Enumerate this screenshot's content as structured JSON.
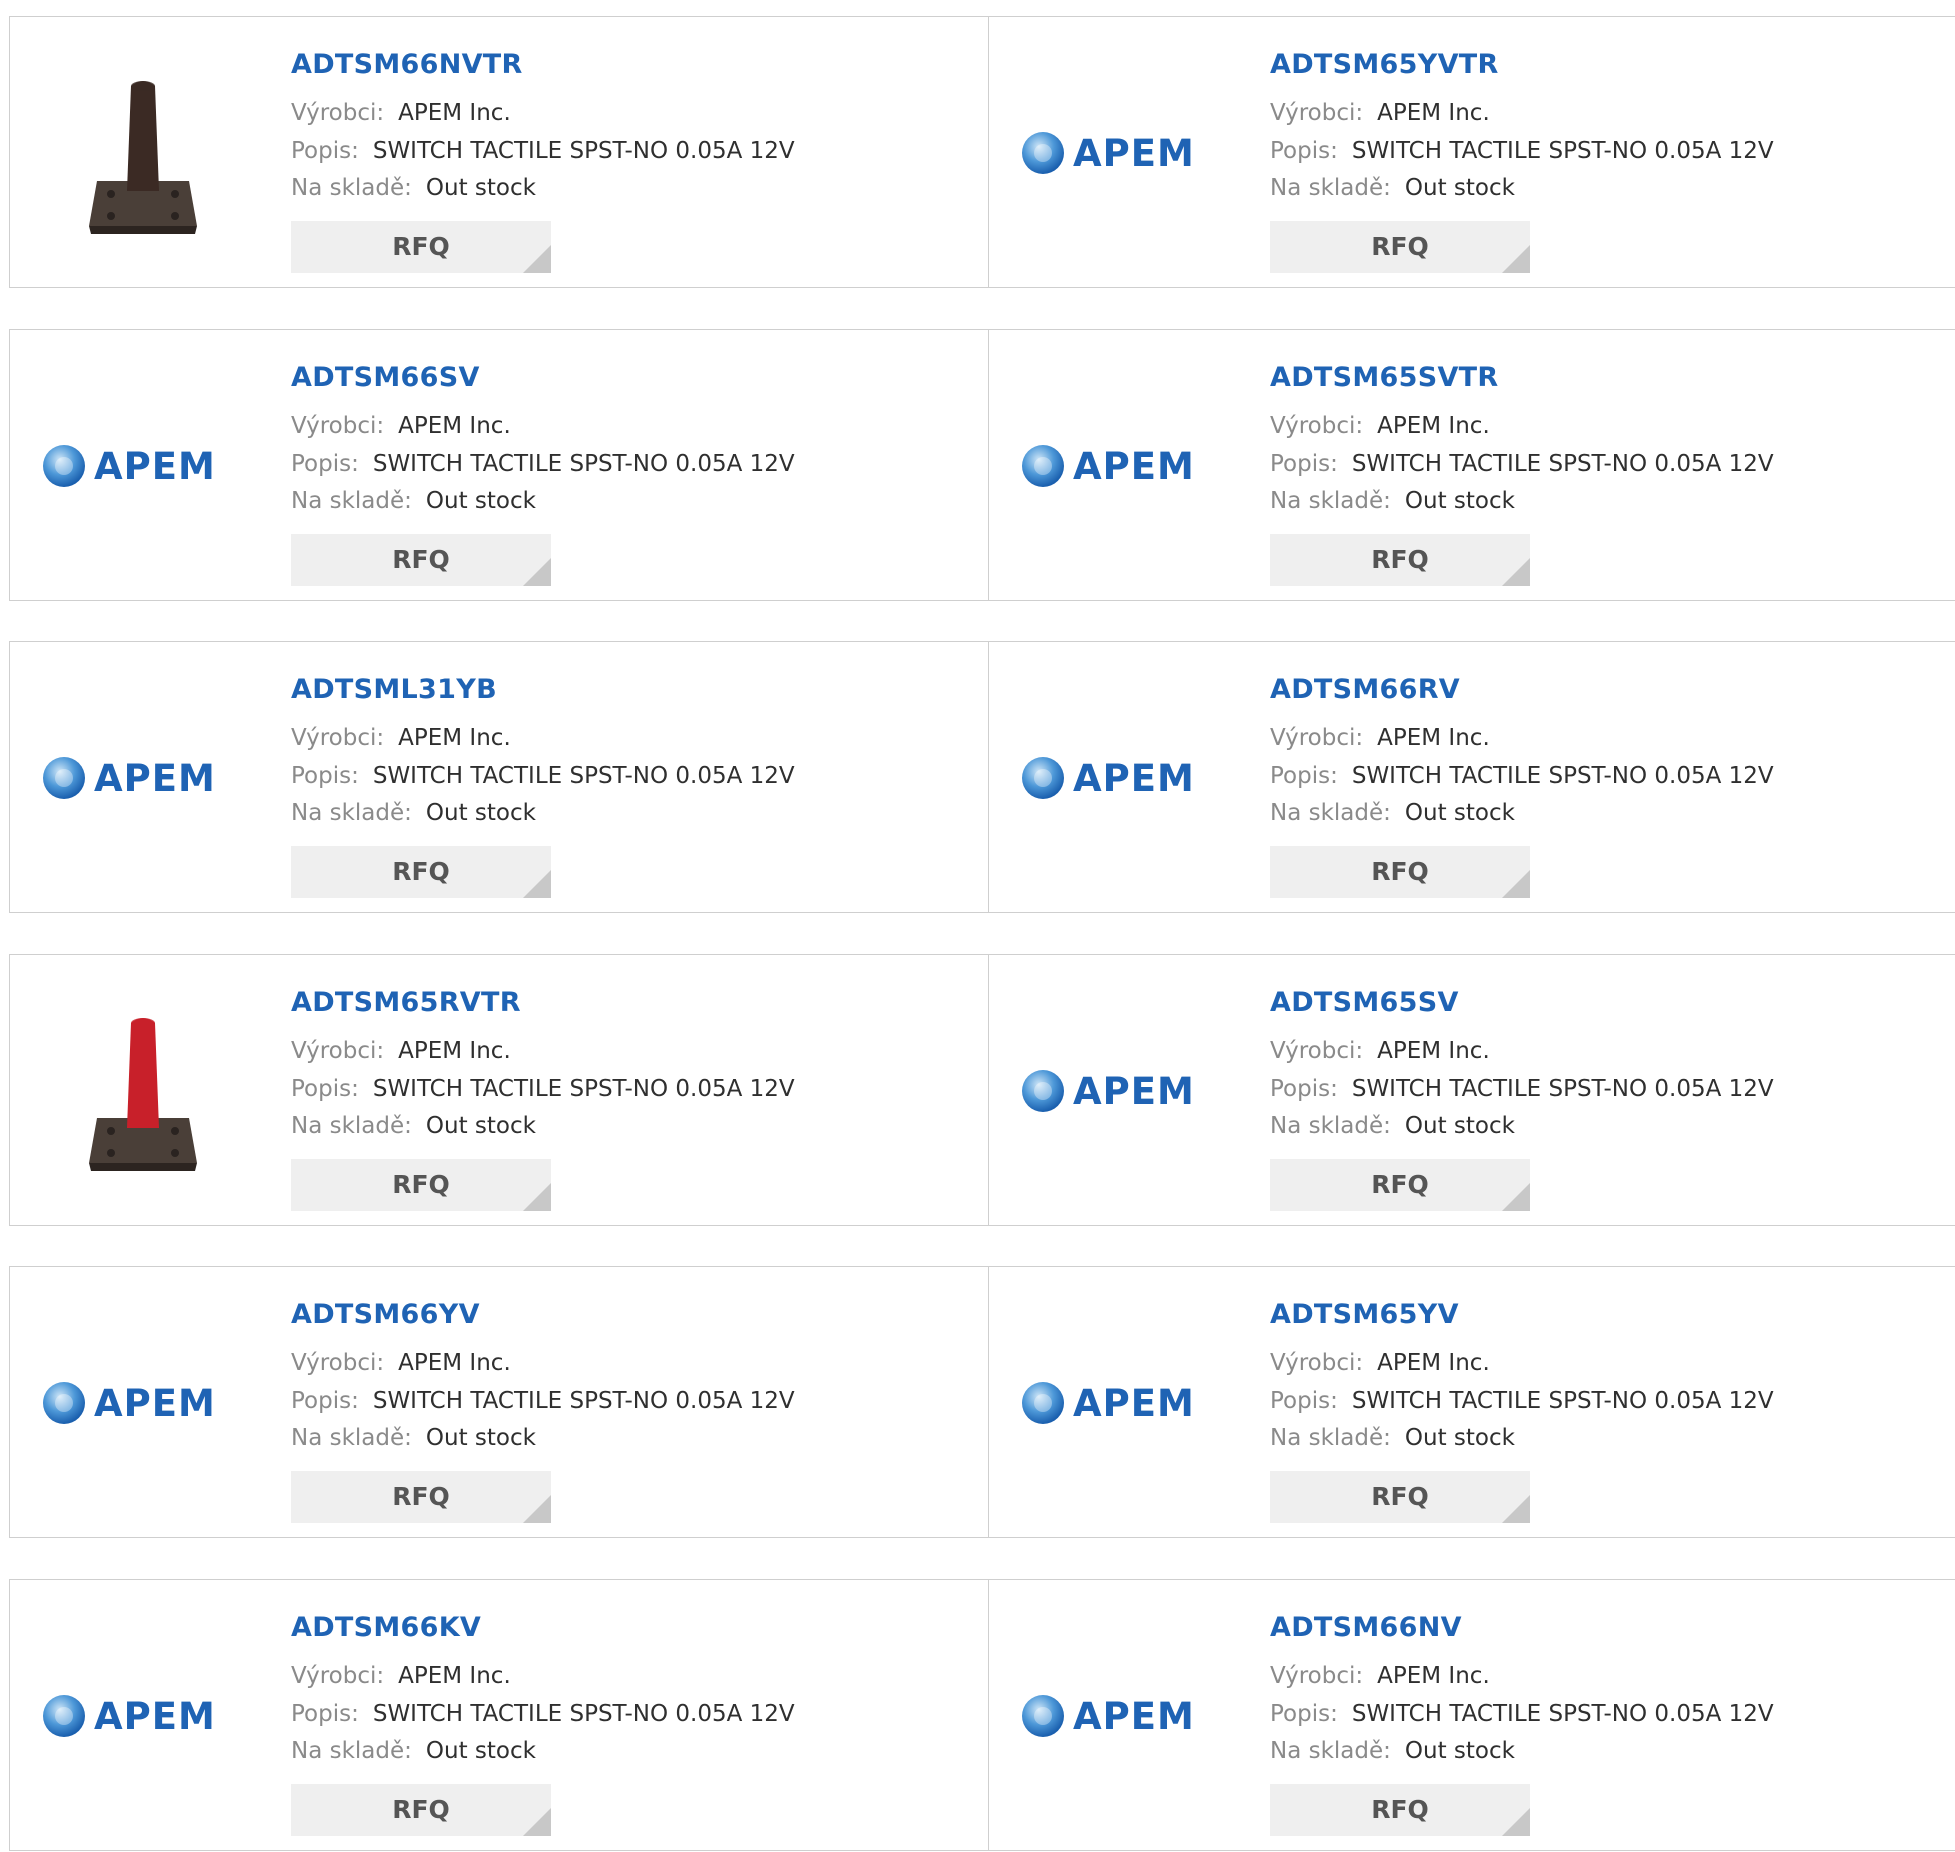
{
  "labels": {
    "manufacturer": "Výrobci:",
    "description": "Popis:",
    "stock": "Na skladě:",
    "rfq": "RFQ"
  },
  "brand": {
    "name": "APEM",
    "color": "#1f63b4"
  },
  "products": [
    {
      "pn": "ADTSM66NVTR",
      "manufacturer": "APEM Inc.",
      "description": "SWITCH TACTILE SPST-NO 0.05A 12V",
      "stock": "Out stock",
      "image": "tactile-switch-brown-photo"
    },
    {
      "pn": "ADTSM65YVTR",
      "manufacturer": "APEM Inc.",
      "description": "SWITCH TACTILE SPST-NO 0.05A 12V",
      "stock": "Out stock",
      "image": "apem-logo"
    },
    {
      "pn": "ADTSM66SV",
      "manufacturer": "APEM Inc.",
      "description": "SWITCH TACTILE SPST-NO 0.05A 12V",
      "stock": "Out stock",
      "image": "apem-logo"
    },
    {
      "pn": "ADTSM65SVTR",
      "manufacturer": "APEM Inc.",
      "description": "SWITCH TACTILE SPST-NO 0.05A 12V",
      "stock": "Out stock",
      "image": "apem-logo"
    },
    {
      "pn": "ADTSML31YB",
      "manufacturer": "APEM Inc.",
      "description": "SWITCH TACTILE SPST-NO 0.05A 12V",
      "stock": "Out stock",
      "image": "apem-logo"
    },
    {
      "pn": "ADTSM66RV",
      "manufacturer": "APEM Inc.",
      "description": "SWITCH TACTILE SPST-NO 0.05A 12V",
      "stock": "Out stock",
      "image": "apem-logo"
    },
    {
      "pn": "ADTSM65RVTR",
      "manufacturer": "APEM Inc.",
      "description": "SWITCH TACTILE SPST-NO 0.05A 12V",
      "stock": "Out stock",
      "image": "tactile-switch-red-photo"
    },
    {
      "pn": "ADTSM65SV",
      "manufacturer": "APEM Inc.",
      "description": "SWITCH TACTILE SPST-NO 0.05A 12V",
      "stock": "Out stock",
      "image": "apem-logo"
    },
    {
      "pn": "ADTSM66YV",
      "manufacturer": "APEM Inc.",
      "description": "SWITCH TACTILE SPST-NO 0.05A 12V",
      "stock": "Out stock",
      "image": "apem-logo"
    },
    {
      "pn": "ADTSM65YV",
      "manufacturer": "APEM Inc.",
      "description": "SWITCH TACTILE SPST-NO 0.05A 12V",
      "stock": "Out stock",
      "image": "apem-logo"
    },
    {
      "pn": "ADTSM66KV",
      "manufacturer": "APEM Inc.",
      "description": "SWITCH TACTILE SPST-NO 0.05A 12V",
      "stock": "Out stock",
      "image": "apem-logo"
    },
    {
      "pn": "ADTSM66NV",
      "manufacturer": "APEM Inc.",
      "description": "SWITCH TACTILE SPST-NO 0.05A 12V",
      "stock": "Out stock",
      "image": "apem-logo"
    }
  ]
}
